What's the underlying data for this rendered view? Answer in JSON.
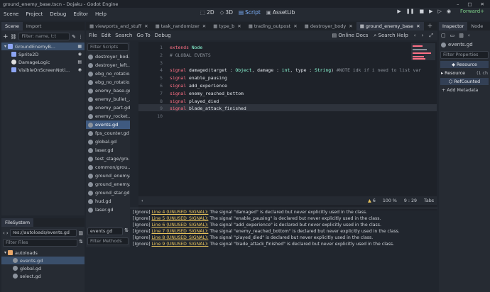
{
  "window": {
    "title": "ground_enemy_base.tscn - Dojaku - Godot Engine"
  },
  "menu": [
    "Scene",
    "Project",
    "Debug",
    "Editor",
    "Help"
  ],
  "workspaces": [
    {
      "label": "2D",
      "active": false
    },
    {
      "label": "3D",
      "active": false
    },
    {
      "label": "Script",
      "active": true
    },
    {
      "label": "AssetLib",
      "active": false
    }
  ],
  "run_icons": [
    "play-icon",
    "pause-icon",
    "stop-icon",
    "play-scene-icon",
    "play-custom-icon",
    "movie-icon"
  ],
  "renderer": "Forward+",
  "scene_dock": {
    "tabs": [
      "Scene",
      "Import"
    ],
    "filter_placeholder": "Filter: name, t:t",
    "nodes": [
      {
        "label": "GroundEnemyB...",
        "icon": "node2d-icon",
        "indent": 0,
        "selected": true
      },
      {
        "label": "Sprite2D",
        "icon": "sprite2d-icon",
        "indent": 1,
        "selected": false
      },
      {
        "label": "DamageLogic",
        "icon": "node-icon",
        "indent": 1,
        "selected": false
      },
      {
        "label": "VisibleOnScreenNoti...",
        "icon": "visible-notifier-icon",
        "indent": 1,
        "selected": false
      }
    ]
  },
  "filesystem": {
    "title": "FileSystem",
    "path": "res://autoloads/events.gd",
    "filter_placeholder": "Filter Files",
    "items": [
      {
        "label": "autoloads",
        "type": "folder",
        "selected": false
      },
      {
        "label": "events.gd",
        "type": "file",
        "selected": true
      },
      {
        "label": "global.gd",
        "type": "file",
        "selected": false
      },
      {
        "label": "select.gd",
        "type": "file",
        "selected": false
      }
    ]
  },
  "script_tabs": [
    {
      "label": "viewports_and_stuff",
      "active": false
    },
    {
      "label": "task_randomizer",
      "active": false
    },
    {
      "label": "type_b",
      "active": false
    },
    {
      "label": "trading_outpost",
      "active": false
    },
    {
      "label": "destroyer_body",
      "active": false
    },
    {
      "label": "ground_enemy_base",
      "active": true
    }
  ],
  "script_menu": [
    "File",
    "Edit",
    "Search",
    "Go To",
    "Debug"
  ],
  "script_toolbar": {
    "online_docs": "Online Docs",
    "search_help": "Search Help"
  },
  "script_list": {
    "filter_placeholder": "Filter Scripts",
    "items": [
      {
        "label": "destroyer_bod...",
        "selected": false
      },
      {
        "label": "destroyer_left...",
        "selected": false
      },
      {
        "label": "ebg_no_rotatio...",
        "selected": false
      },
      {
        "label": "ebg_no_rotatio...",
        "selected": false
      },
      {
        "label": "enemy_base.gd",
        "selected": false
      },
      {
        "label": "enemy_bullet_...",
        "selected": false
      },
      {
        "label": "enemy_part.gd",
        "selected": false
      },
      {
        "label": "enemy_rocket....",
        "selected": false
      },
      {
        "label": "events.gd",
        "selected": true
      },
      {
        "label": "fps_counter.gd",
        "selected": false
      },
      {
        "label": "global.gd",
        "selected": false
      },
      {
        "label": "laser.gd",
        "selected": false
      },
      {
        "label": "test_stage/gro...",
        "selected": false
      },
      {
        "label": "common/grou...",
        "selected": false
      },
      {
        "label": "ground_enemy...",
        "selected": false
      },
      {
        "label": "ground_enemy...",
        "selected": false
      },
      {
        "label": "ground_star.gd",
        "selected": false
      },
      {
        "label": "hud.gd",
        "selected": false
      },
      {
        "label": "laser.gd",
        "selected": false
      }
    ],
    "current": "events.gd",
    "methods_placeholder": "Filter Methods"
  },
  "code_lines": [
    {
      "n": "1",
      "parts": [
        {
          "t": "extends ",
          "c": "kw"
        },
        {
          "t": "Node",
          "c": "ty"
        }
      ]
    },
    {
      "n": "2",
      "parts": [
        {
          "t": "# GLOBAL EVENTS",
          "c": "cm"
        }
      ]
    },
    {
      "n": "3",
      "parts": []
    },
    {
      "n": "4",
      "parts": [
        {
          "t": "signal ",
          "c": "kw"
        },
        {
          "t": "damaged(target : ",
          "c": "fn"
        },
        {
          "t": "Object",
          "c": "ty"
        },
        {
          "t": ", damage : ",
          "c": "fn"
        },
        {
          "t": "int",
          "c": "ty"
        },
        {
          "t": ", type : ",
          "c": "fn"
        },
        {
          "t": "String",
          "c": "ty"
        },
        {
          "t": ") ",
          "c": "fn"
        },
        {
          "t": "#NOTE idk if i need to list var",
          "c": "cm"
        }
      ]
    },
    {
      "n": "5",
      "parts": [
        {
          "t": "signal ",
          "c": "kw"
        },
        {
          "t": "enable_pausing",
          "c": "fn"
        }
      ]
    },
    {
      "n": "6",
      "parts": [
        {
          "t": "signal ",
          "c": "kw"
        },
        {
          "t": "add_experience",
          "c": "fn"
        }
      ]
    },
    {
      "n": "7",
      "parts": [
        {
          "t": "signal ",
          "c": "kw"
        },
        {
          "t": "enemy_reached_bottom",
          "c": "fn"
        }
      ]
    },
    {
      "n": "8",
      "parts": [
        {
          "t": "signal ",
          "c": "kw"
        },
        {
          "t": "played_died",
          "c": "fn"
        }
      ]
    },
    {
      "n": "9",
      "parts": [
        {
          "t": "signal ",
          "c": "kw"
        },
        {
          "t": "blade_attack_finished",
          "c": "fn"
        }
      ]
    },
    {
      "n": "10",
      "parts": []
    }
  ],
  "status": {
    "warnings": "6",
    "zoom": "100 %",
    "line": "9",
    "col": "29",
    "indent": "Tabs"
  },
  "output": [
    {
      "tag": "[Ignore]",
      "link": "Line 4 (UNUSED_SIGNAL):",
      "msg": "The signal \"damaged\" is declared but never explicitly used in the class."
    },
    {
      "tag": "[Ignore]",
      "link": "Line 5 (UNUSED_SIGNAL):",
      "msg": "The signal \"enable_pausing\" is declared but never explicitly used in the class."
    },
    {
      "tag": "[Ignore]",
      "link": "Line 6 (UNUSED_SIGNAL):",
      "msg": "The signal \"add_experience\" is declared but never explicitly used in the class."
    },
    {
      "tag": "[Ignore]",
      "link": "Line 7 (UNUSED_SIGNAL):",
      "msg": "The signal \"enemy_reached_bottom\" is declared but never explicitly used in the class."
    },
    {
      "tag": "[Ignore]",
      "link": "Line 8 (UNUSED_SIGNAL):",
      "msg": "The signal \"played_died\" is declared but never explicitly used in the class."
    },
    {
      "tag": "[Ignore]",
      "link": "Line 9 (UNUSED_SIGNAL):",
      "msg": "The signal \"blade_attack_finished\" is declared but never explicitly used in the class."
    }
  ],
  "inspector": {
    "tabs": [
      "Inspector",
      "Node"
    ],
    "file": "events.gd",
    "filter_placeholder": "Filter Properties",
    "category": "Resource",
    "prop_label": "Resource",
    "prop_value": "(1 ch",
    "refcounted": "RefCounted",
    "add_metadata": "Add Metadata"
  },
  "colors": {
    "accent": "#4b8ee6",
    "keyword": "#ff7085",
    "type": "#8effda",
    "comment": "#8a9099",
    "warning": "#e8c35c"
  }
}
